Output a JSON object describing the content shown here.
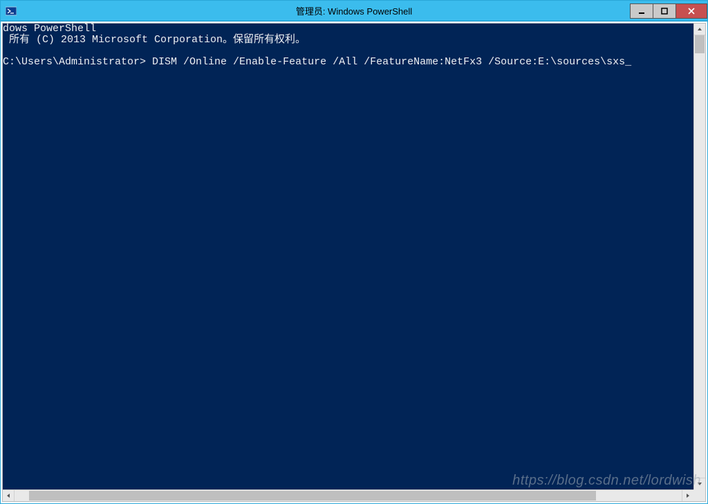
{
  "window": {
    "title": "管理员: Windows PowerShell"
  },
  "console": {
    "line1": "dows PowerShell",
    "line2": " 所有 (C) 2013 Microsoft Corporation。保留所有权利。",
    "blank": "",
    "promptline": "C:\\Users\\Administrator> DISM /Online /Enable-Feature /All /FeatureName:NetFx3 /Source:E:\\sources\\sxs",
    "cursor": "_"
  },
  "watermark": "https://blog.csdn.net/lordwish"
}
